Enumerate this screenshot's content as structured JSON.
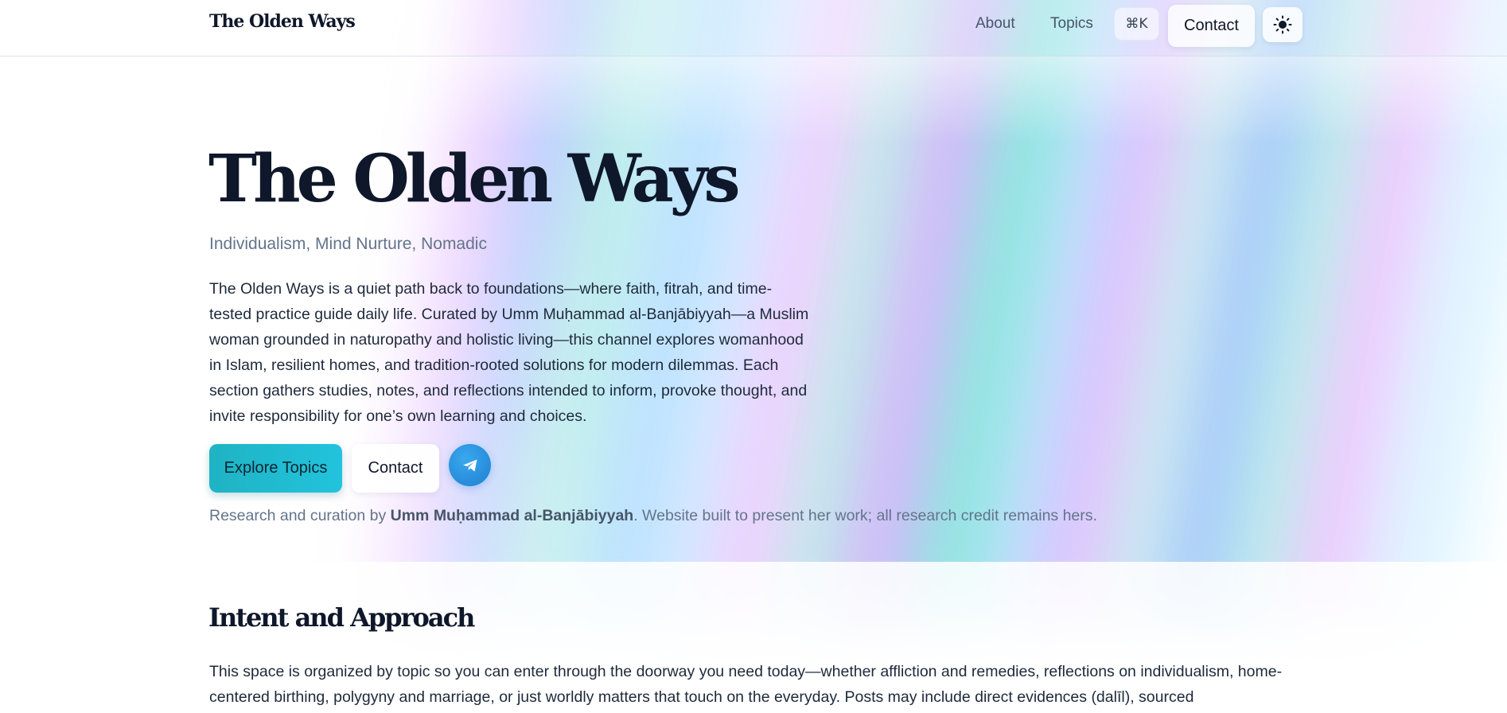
{
  "header": {
    "brand": "The Olden Ways",
    "nav": {
      "about": "About",
      "topics": "Topics",
      "shortcut": "⌘K",
      "contact": "Contact"
    },
    "theme_toggle_icon": "sun-icon"
  },
  "hero": {
    "title": "The Olden Ways",
    "subtitle": "Individualism, Mind Nurture, Nomadic",
    "description": "The Olden Ways is a quiet path back to foundations—where faith, fitrah, and time-tested practice guide daily life. Curated by Umm Muḥammad al-Banjābiyyah—a Muslim woman grounded in naturopathy and holistic living—this channel explores womanhood in Islam, resilient homes, and tradition-rooted solutions for modern dilemmas. Each section gathers studies, notes, and reflections intended to inform, provoke thought, and invite responsibility for one’s own learning and choices.",
    "buttons": {
      "explore": "Explore Topics",
      "contact": "Contact",
      "telegram_icon": "telegram-icon"
    },
    "credit": {
      "prefix": "Research and curation by ",
      "author": "Umm Muḥammad al-Banjābiyyah",
      "suffix": ". Website built to present her work; all research credit remains hers."
    }
  },
  "intent": {
    "title": "Intent and Approach",
    "body": "This space is organized by topic so you can enter through the doorway you need today—whether affliction and remedies, reflections on individualism, home-centered birthing, polygyny and marriage, or just worldly matters that touch on the everyday. Posts may include direct evidences (dalīl), sourced"
  },
  "colors": {
    "accent_start": "#1fb3c3",
    "accent_end": "#22c3dd",
    "heading": "#0f172a",
    "muted": "#64748b",
    "telegram": "#1e7fd1"
  }
}
